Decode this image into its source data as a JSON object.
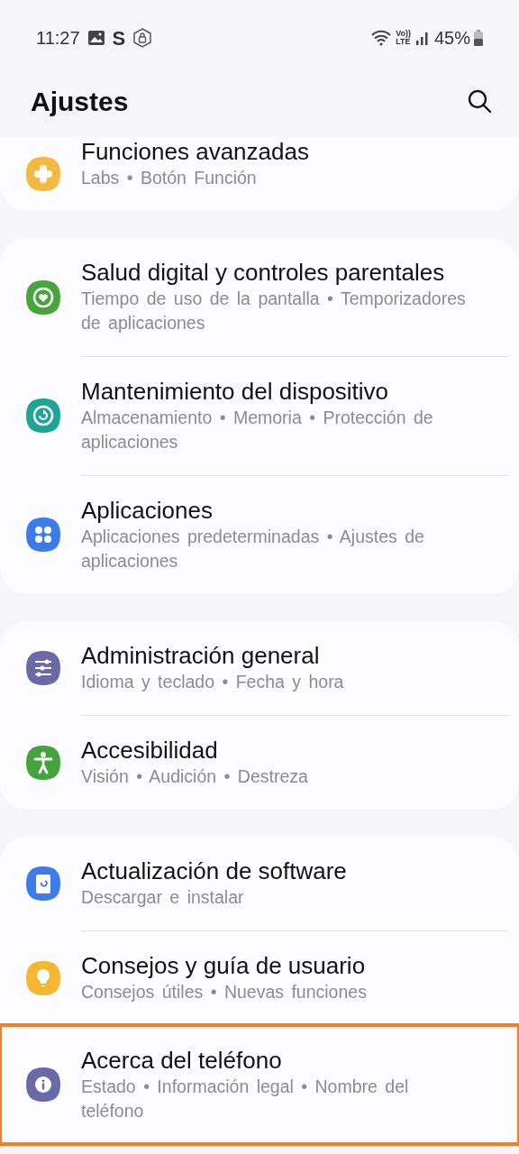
{
  "status_bar": {
    "time": "11:27",
    "notification_letter": "S",
    "network_top": "Vo))",
    "network_bottom": "LTE",
    "battery": "45%"
  },
  "header": {
    "title": "Ajustes"
  },
  "groups": [
    {
      "items": [
        {
          "kind": "gear-flower",
          "color": "#f5b942",
          "title": "Funciones avanzadas",
          "subtitle": "Labs • Botón Función",
          "highlighted": false
        }
      ]
    },
    {
      "items": [
        {
          "kind": "heart-ring",
          "color": "#48a53b",
          "title": "Salud digital y controles parentales",
          "subtitle": "Tiempo de uso de la pantalla • Temporizadores de aplicaciones",
          "highlighted": false
        },
        {
          "kind": "refresh-ring",
          "color": "#1fa597",
          "title": "Mantenimiento del dispositivo",
          "subtitle": "Almacenamiento • Memoria • Protección de aplicaciones",
          "highlighted": false
        },
        {
          "kind": "dots",
          "color": "#3c7bea",
          "title": "Aplicaciones",
          "subtitle": "Aplicaciones predeterminadas • Ajustes de aplicaciones",
          "highlighted": false
        }
      ]
    },
    {
      "items": [
        {
          "kind": "sliders",
          "color": "#6a6aa8",
          "title": "Administración general",
          "subtitle": "Idioma y teclado • Fecha y hora",
          "highlighted": false
        },
        {
          "kind": "person",
          "color": "#44a33a",
          "title": "Accesibilidad",
          "subtitle": "Visión • Audición • Destreza",
          "highlighted": false
        }
      ]
    },
    {
      "items": [
        {
          "kind": "update",
          "color": "#3c7bea",
          "title": "Actualización de software",
          "subtitle": "Descargar e instalar",
          "highlighted": false
        },
        {
          "kind": "bulb",
          "color": "#f5b630",
          "title": "Consejos y guía de usuario",
          "subtitle": "Consejos útiles • Nuevas funciones",
          "highlighted": false
        },
        {
          "kind": "info",
          "color": "#6a6aa8",
          "title": "Acerca del teléfono",
          "subtitle": "Estado • Información legal • Nombre del teléfono",
          "highlighted": true
        }
      ]
    }
  ]
}
